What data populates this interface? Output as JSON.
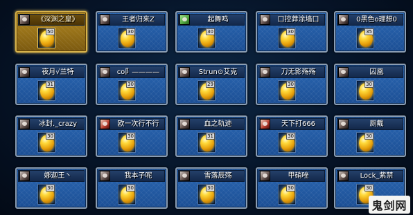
{
  "cards": [
    {
      "name": "《深渊之皇》",
      "count": "50",
      "selected": true,
      "avatar": "dark"
    },
    {
      "name": "王者归来Z",
      "count": "30",
      "selected": false,
      "avatar": "dark"
    },
    {
      "name": "起舞鸣",
      "count": "30",
      "selected": false,
      "avatar": "green"
    },
    {
      "name": "口控莽涂墙口",
      "count": "30",
      "selected": false,
      "avatar": "dark"
    },
    {
      "name": "0黑色o理想0",
      "count": "35",
      "selected": false,
      "avatar": "dark"
    },
    {
      "name": "夜月√兰特",
      "count": "31",
      "selected": false,
      "avatar": "dark"
    },
    {
      "name": "co阝————",
      "count": "30",
      "selected": false,
      "avatar": "dark"
    },
    {
      "name": "Strun⊙艾克",
      "count": "29",
      "selected": false,
      "avatar": "dark"
    },
    {
      "name": "刀无影殇殇",
      "count": "30",
      "selected": false,
      "avatar": "dark"
    },
    {
      "name": "囚凰",
      "count": "30",
      "selected": false,
      "avatar": "dark"
    },
    {
      "name": "冰封._crazy",
      "count": "30",
      "selected": false,
      "avatar": "dark"
    },
    {
      "name": "欧一次行不行",
      "count": "30",
      "selected": false,
      "avatar": "red"
    },
    {
      "name": "血之轨迹",
      "count": "31",
      "selected": false,
      "avatar": "dark"
    },
    {
      "name": "天下打666",
      "count": "30",
      "selected": false,
      "avatar": "red"
    },
    {
      "name": "厕戴",
      "count": "30",
      "selected": false,
      "avatar": "dark"
    },
    {
      "name": "娜迦王丶",
      "count": "30",
      "selected": false,
      "avatar": "dark"
    },
    {
      "name": "我本子呢",
      "count": "30",
      "selected": false,
      "avatar": "dark"
    },
    {
      "name": "雪落辰殇",
      "count": "30",
      "selected": false,
      "avatar": "dark"
    },
    {
      "name": "甲硝唑",
      "count": "30",
      "selected": false,
      "avatar": "dark"
    },
    {
      "name": "Lock_紫禁",
      "count": "30",
      "selected": false,
      "avatar": "dark"
    }
  ],
  "watermark": "鬼剑网"
}
